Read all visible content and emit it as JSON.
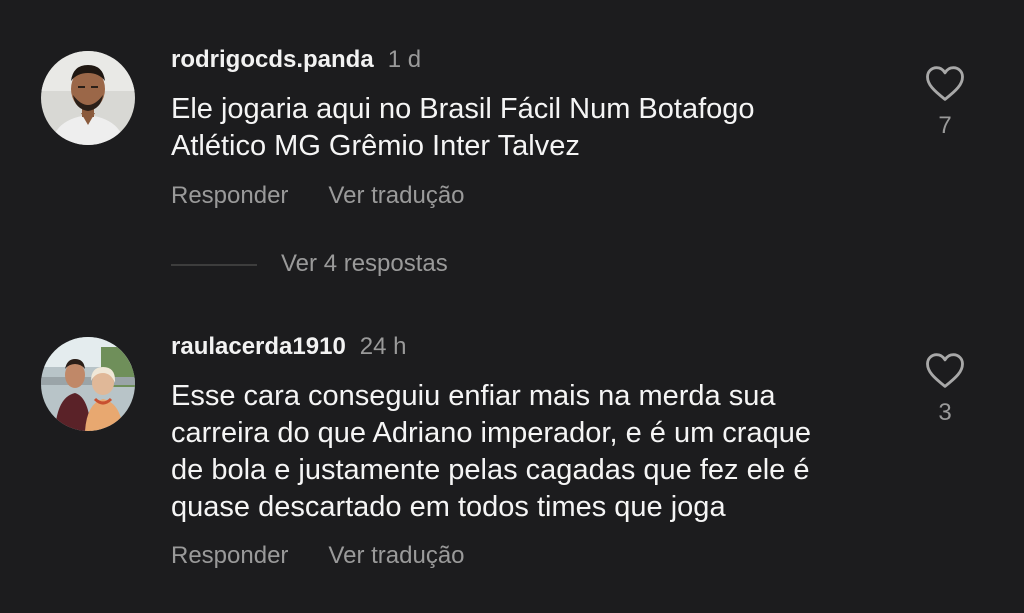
{
  "comments": [
    {
      "username": "rodrigocds.panda",
      "time": "1 d",
      "lines": [
        "Ele jogaria aqui no Brasil Fácil Num Botafogo",
        "Atlético MG Grêmio Inter Talvez"
      ],
      "likes": "7",
      "reply_label": "Responder",
      "translate_label": "Ver tradução"
    },
    {
      "username": "raulacerda1910",
      "time": "24 h",
      "lines": [
        "Esse cara conseguiu enfiar mais na merda sua",
        "carreira do que Adriano imperador, e é um craque",
        "de bola e justamente pelas cagadas que fez ele é",
        "quase descartado em todos times que joga"
      ],
      "likes": "3",
      "reply_label": "Responder",
      "translate_label": "Ver tradução"
    }
  ],
  "view_replies": "Ver 4 respostas",
  "icons": {
    "like": "heart-outline-icon"
  },
  "colors": {
    "background": "#1c1c1e",
    "text_primary": "#f5f5f5",
    "text_secondary": "#9a9a9a"
  }
}
